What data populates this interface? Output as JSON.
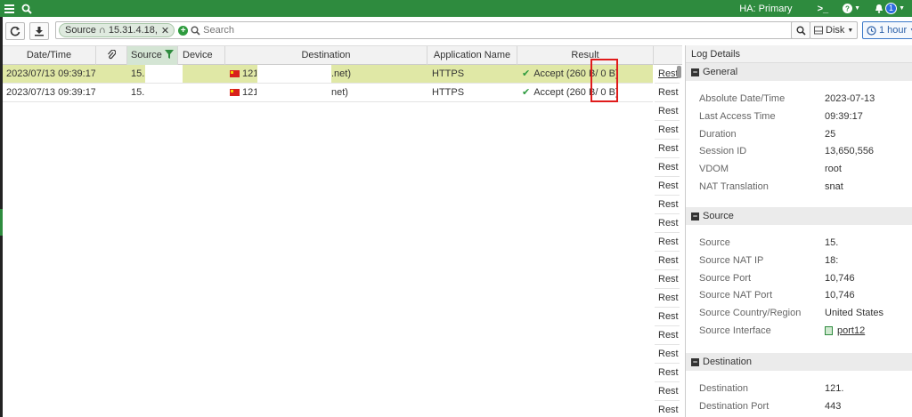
{
  "topbar": {
    "menu_icon": "menu-icon",
    "search_icon": "search-icon",
    "ha_status": "HA: Primary",
    "cli_icon": "terminal-icon",
    "help_icon": "help-icon",
    "bell_icon": "bell-icon",
    "notification_count": "1",
    "accent": "#2e8b3e"
  },
  "toolbar": {
    "refresh_icon": "refresh-icon",
    "download_icon": "download-icon",
    "filter_chip": "Source ∩ 15.31.4.18,",
    "chip_close": "✕",
    "search_placeholder": "Search",
    "log_location": "Disk",
    "time_range": "1 hour"
  },
  "table": {
    "columns": [
      "Date/Time",
      "",
      "Source",
      "Device",
      "Destination",
      "Application Name",
      "Result"
    ],
    "rows": [
      {
        "datetime": "2023/07/13 09:39:17",
        "source": "15.",
        "destination_ip": "121.",
        "destination_host": ".net)",
        "application": "HTTPS",
        "result": "Accept (260 B / 0 B)",
        "result_a": "Accept (260 B",
        "result_b": "/ 0 B)",
        "selected": true
      },
      {
        "datetime": "2023/07/13 09:39:17",
        "source": "15.",
        "destination_ip": "121.",
        "destination_host": "net)",
        "application": "HTTPS",
        "result": "Accept (260 B / 0 B)",
        "result_a": "Accept (260 B",
        "result_b": "/ 0 B)",
        "selected": false
      }
    ],
    "rest_label": "Rest",
    "rest_count": 19
  },
  "log_details": {
    "title": "Log Details",
    "general": {
      "header": "General",
      "fields": [
        {
          "label": "Absolute Date/Time",
          "value": "2023-07-13"
        },
        {
          "label": "Last Access Time",
          "value": "09:39:17"
        },
        {
          "label": "Duration",
          "value": "25"
        },
        {
          "label": "Session ID",
          "value": "13,650,556"
        },
        {
          "label": "VDOM",
          "value": "root"
        },
        {
          "label": "NAT Translation",
          "value": "snat"
        }
      ]
    },
    "source": {
      "header": "Source",
      "fields": [
        {
          "label": "Source",
          "value": "15."
        },
        {
          "label": "Source NAT IP",
          "value": "18:"
        },
        {
          "label": "Source Port",
          "value": "10,746"
        },
        {
          "label": "Source NAT Port",
          "value": "10,746"
        },
        {
          "label": "Source Country/Region",
          "value": "United States"
        },
        {
          "label": "Source Interface",
          "value": "port12"
        }
      ]
    },
    "destination": {
      "header": "Destination",
      "fields": [
        {
          "label": "Destination",
          "value": "121."
        },
        {
          "label": "Destination Port",
          "value": "443"
        }
      ]
    }
  }
}
